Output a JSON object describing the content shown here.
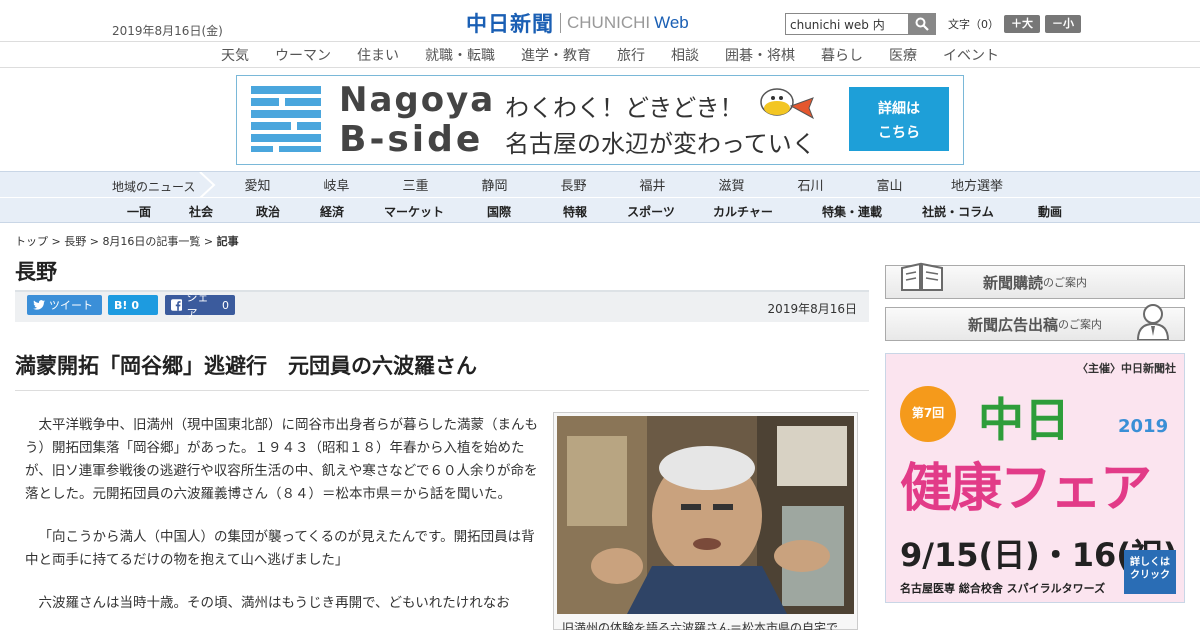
{
  "header": {
    "date": "2019年8月16日(金)",
    "logo_jp": "中日新聞",
    "logo_en": "CHUNICHI",
    "logo_web": "Web",
    "search_value": "chunichi web 内",
    "fontsize_label": "文字（0）",
    "fontsize_up": "＋大",
    "fontsize_down": "－小"
  },
  "category_nav": [
    "天気",
    "ウーマン",
    "住まい",
    "就職・転職",
    "進学・教育",
    "旅行",
    "相談",
    "囲碁・将棋",
    "暮らし",
    "医療",
    "イベント"
  ],
  "banner": {
    "title_line1": "Nagoya",
    "title_line2": "B-side",
    "copy_line1": "わくわく！どきどき！",
    "copy_line2": "名古屋の水辺が変わっていく",
    "cta_line1": "詳細は",
    "cta_line2": "こちら"
  },
  "region_nav": {
    "label": "地域のニュース",
    "items": [
      "愛知",
      "岐阜",
      "三重",
      "静岡",
      "長野",
      "福井",
      "滋賀",
      "石川",
      "富山",
      "地方選挙"
    ]
  },
  "main_nav": [
    "一面",
    "社会",
    "政治",
    "経済",
    "マーケット",
    "国際",
    "特報",
    "スポーツ",
    "カルチャー",
    "特集・連載",
    "社説・コラム",
    "動画"
  ],
  "breadcrumb": {
    "items": [
      "トップ",
      "長野",
      "8月16日の記事一覧"
    ],
    "current": "記事",
    "separator": " > "
  },
  "section_title": "長野",
  "share": {
    "tweet": "ツイート",
    "hatena": "B!",
    "hatena_count": "0",
    "facebook": "シェア",
    "facebook_count": "0"
  },
  "article": {
    "date": "2019年8月16日",
    "headline": "満蒙開拓「岡谷郷」逃避行　元団員の六波羅さん",
    "paragraphs": [
      "太平洋戦争中、旧満州（現中国東北部）に岡谷市出身者らが暮らした満蒙（まんもう）開拓団集落「岡谷郷」があった。１９４３（昭和１８）年春から入植を始めたが、旧ソ連軍参戦後の逃避行や収容所生活の中、飢えや寒さなどで６０人余りが命を落とした。元開拓団員の六波羅義博さん（８４）＝松本市県＝から話を聞いた。",
      "「向こうから満人（中国人）の集団が襲ってくるのが見えたんです。開拓団員は背中と両手に持てるだけの物を抱えて山へ逃げました」",
      "六波羅さんは当時十歳。その頃、満州はもうじき再開で、どもいれたけれなお"
    ],
    "photo_caption": "旧満州の体験を語る六波羅さん＝松本市県の自宅で"
  },
  "sidebar": {
    "subscribe_main": "新聞購読",
    "subscribe_sub": "のご案内",
    "adpost_main": "新聞広告出稿",
    "adpost_sub": "のご案内"
  },
  "ad": {
    "organizer": "〈主催〉中日新聞社",
    "edition": "第7回",
    "name_line1": "中日",
    "year": "2019",
    "name_line2": "健康フェア",
    "dates": "9/15(日)・16(祝)",
    "venue": "名古屋医専 総合校舎 スパイラルタワーズ",
    "click_line1": "詳しくは",
    "click_line2": "クリック"
  },
  "colors": {
    "brand_blue": "#1a5fb4",
    "nav_bg": "#e7eef7",
    "banner_cta": "#1e9fd8",
    "twitter": "#3b8fd8",
    "hatena": "#1d9be0",
    "facebook": "#3b5b9d",
    "ad_pink": "#e23b88",
    "ad_green": "#2e9d3a"
  },
  "icons": [
    "search-icon",
    "twitter-bird-icon",
    "facebook-icon",
    "book-icon",
    "person-icon",
    "fish-mascot-icon"
  ]
}
